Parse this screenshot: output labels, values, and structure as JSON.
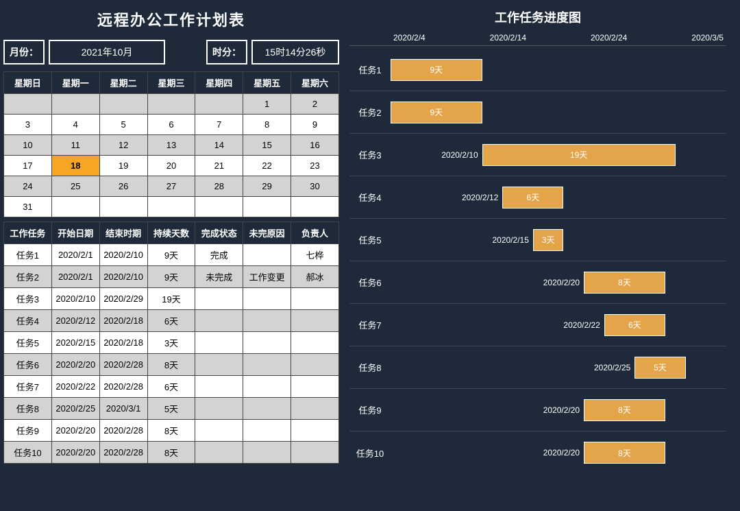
{
  "header": {
    "title": "远程办公工作计划表",
    "month_label": "月份：",
    "month_value": "2021年10月",
    "time_label": "时分：",
    "time_value": "15时14分26秒"
  },
  "calendar": {
    "headers": [
      "星期日",
      "星期一",
      "星期二",
      "星期三",
      "星期四",
      "星期五",
      "星期六"
    ],
    "rows": [
      [
        "",
        "",
        "",
        "",
        "",
        "1",
        "2"
      ],
      [
        "3",
        "4",
        "5",
        "6",
        "7",
        "8",
        "9"
      ],
      [
        "10",
        "11",
        "12",
        "13",
        "14",
        "15",
        "16"
      ],
      [
        "17",
        "18",
        "19",
        "20",
        "21",
        "22",
        "23"
      ],
      [
        "24",
        "25",
        "26",
        "27",
        "28",
        "29",
        "30"
      ],
      [
        "31",
        "",
        "",
        "",
        "",
        "",
        ""
      ]
    ],
    "alt_rows": [
      0,
      2,
      4
    ],
    "highlight": {
      "row": 3,
      "col": 1
    }
  },
  "tasks_table": {
    "headers": [
      "工作任务",
      "开始日期",
      "结束时期",
      "持续天数",
      "完成状态",
      "未完原因",
      "负责人"
    ],
    "rows": [
      [
        "任务1",
        "2020/2/1",
        "2020/2/10",
        "9天",
        "完成",
        "",
        "七桦"
      ],
      [
        "任务2",
        "2020/2/1",
        "2020/2/10",
        "9天",
        "未完成",
        "工作变更",
        "郝冰"
      ],
      [
        "任务3",
        "2020/2/10",
        "2020/2/29",
        "19天",
        "",
        "",
        ""
      ],
      [
        "任务4",
        "2020/2/12",
        "2020/2/18",
        "6天",
        "",
        "",
        ""
      ],
      [
        "任务5",
        "2020/2/15",
        "2020/2/18",
        "3天",
        "",
        "",
        ""
      ],
      [
        "任务6",
        "2020/2/20",
        "2020/2/28",
        "8天",
        "",
        "",
        ""
      ],
      [
        "任务7",
        "2020/2/22",
        "2020/2/28",
        "6天",
        "",
        "",
        ""
      ],
      [
        "任务8",
        "2020/2/25",
        "2020/3/1",
        "5天",
        "",
        "",
        ""
      ],
      [
        "任务9",
        "2020/2/20",
        "2020/2/28",
        "8天",
        "",
        "",
        ""
      ],
      [
        "任务10",
        "2020/2/20",
        "2020/2/28",
        "8天",
        "",
        "",
        ""
      ]
    ],
    "alt_rows": [
      1,
      3,
      5,
      7,
      9
    ]
  },
  "chart_data": {
    "type": "bar",
    "title": "工作任务进度图",
    "x_ticks": [
      "2020/2/4",
      "2020/2/14",
      "2020/2/24",
      "2020/3/5"
    ],
    "x_domain": [
      "2020/2/1",
      "2020/3/5"
    ],
    "series": [
      {
        "name": "任务1",
        "start": "2020/2/1",
        "duration_days": 9,
        "label": "9天",
        "pre_label": ""
      },
      {
        "name": "任务2",
        "start": "2020/2/1",
        "duration_days": 9,
        "label": "9天",
        "pre_label": ""
      },
      {
        "name": "任务3",
        "start": "2020/2/10",
        "duration_days": 19,
        "label": "19天",
        "pre_label": "2020/2/10"
      },
      {
        "name": "任务4",
        "start": "2020/2/12",
        "duration_days": 6,
        "label": "6天",
        "pre_label": "2020/2/12"
      },
      {
        "name": "任务5",
        "start": "2020/2/15",
        "duration_days": 3,
        "label": "3天",
        "pre_label": "2020/2/15"
      },
      {
        "name": "任务6",
        "start": "2020/2/20",
        "duration_days": 8,
        "label": "8天",
        "pre_label": "2020/2/20"
      },
      {
        "name": "任务7",
        "start": "2020/2/22",
        "duration_days": 6,
        "label": "6天",
        "pre_label": "2020/2/22"
      },
      {
        "name": "任务8",
        "start": "2020/2/25",
        "duration_days": 5,
        "label": "5天",
        "pre_label": "2020/2/25"
      },
      {
        "name": "任务9",
        "start": "2020/2/20",
        "duration_days": 8,
        "label": "8天",
        "pre_label": "2020/2/20"
      },
      {
        "name": "任务10",
        "start": "2020/2/20",
        "duration_days": 8,
        "label": "8天",
        "pre_label": "2020/2/20"
      }
    ]
  }
}
